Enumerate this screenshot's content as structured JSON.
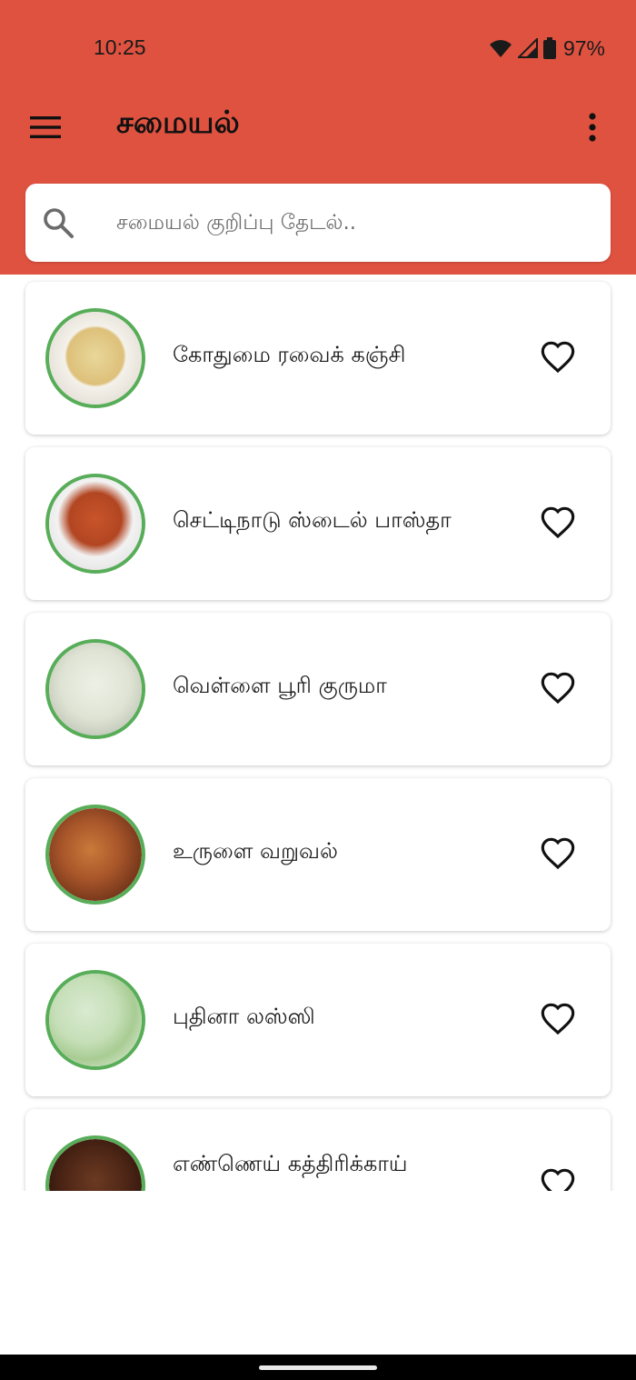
{
  "colors": {
    "header_bg": "#E05240",
    "thumb_border": "#58AD59",
    "nav_bar": "#000000"
  },
  "status_bar": {
    "time": "10:25",
    "battery": "97%",
    "icons": [
      "wifi-icon",
      "signal-icon",
      "battery-icon"
    ]
  },
  "app_bar": {
    "title": "சமையல்",
    "menu_icon": "hamburger-menu-icon",
    "overflow_icon": "more-vert-icon"
  },
  "search": {
    "placeholder": "சமையல் குறிப்பு தேடல்..",
    "value": "",
    "icon": "search-icon"
  },
  "recipes": [
    {
      "name": "கோதுமை ரவைக் கஞ்சி",
      "favorite": false,
      "image": "porridge bowl"
    },
    {
      "name": "செட்டிநாடு ஸ்டைல் பாஸ்தா",
      "favorite": false,
      "image": "pasta bowl"
    },
    {
      "name": "வெள்ளை பூரி குருமா",
      "favorite": false,
      "image": "white kurma"
    },
    {
      "name": "உருளை வறுவல்",
      "favorite": false,
      "image": "potato fry"
    },
    {
      "name": "புதினா லஸ்ஸி",
      "favorite": false,
      "image": "mint lassi"
    },
    {
      "name": "எண்ணெய் கத்திரிக்காய்",
      "favorite": false,
      "image": "brinjal curry"
    }
  ]
}
